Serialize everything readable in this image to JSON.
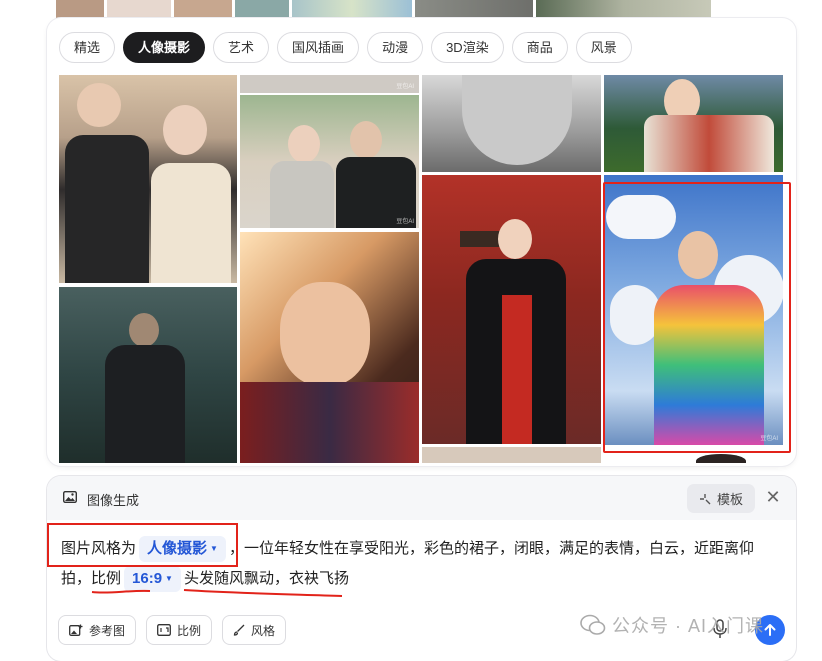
{
  "tabs": [
    {
      "label": "精选",
      "active": false
    },
    {
      "label": "人像摄影",
      "active": true
    },
    {
      "label": "艺术",
      "active": false
    },
    {
      "label": "国风插画",
      "active": false
    },
    {
      "label": "动漫",
      "active": false
    },
    {
      "label": "3D渲染",
      "active": false
    },
    {
      "label": "商品",
      "active": false
    },
    {
      "label": "风景",
      "active": false
    }
  ],
  "gallery": {
    "watermark": "豆包AI"
  },
  "generator": {
    "title": "图像生成",
    "template_label": "模板",
    "close_label": "✕",
    "prompt": {
      "part1": "图片风格为",
      "style_chip": "人像摄影",
      "part2": "，一位年轻女性在享受阳光，彩色的裙子，闭眼，满足的表情，白云，近距离仰拍，比例",
      "ratio_chip": "16:9",
      "part3": "头发随风飘动，衣袂飞扬"
    },
    "tools": {
      "reference": "参考图",
      "ratio": "比例",
      "style": "风格"
    }
  },
  "watermark_text": "公众号 · AI入门课",
  "colors": {
    "accent": "#2b6ef6",
    "annotation_red": "#e2231a",
    "active_tab": "#1d1d1f"
  }
}
